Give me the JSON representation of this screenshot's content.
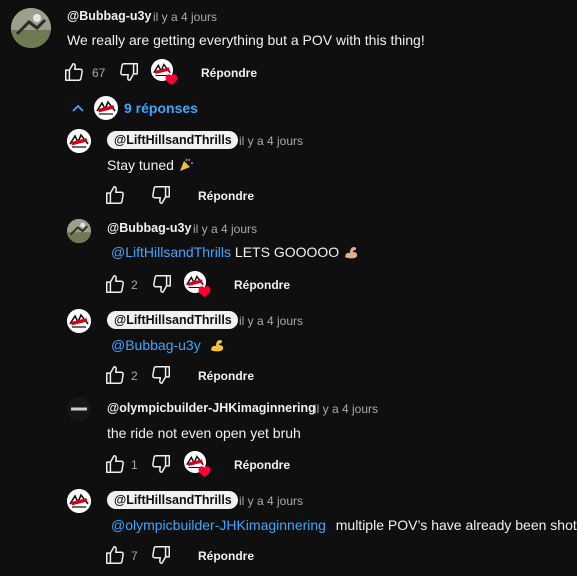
{
  "comments": {
    "c1": {
      "author": "@Bubbag-u3y",
      "time": "il y a 4 jours",
      "text": "We really are getting everything but a POV with this thing!",
      "likes": "67",
      "reply": "Répondre"
    },
    "toggle": {
      "label": "9 réponses"
    },
    "r1": {
      "author": "@LiftHillsandThrills",
      "time": "il y a 4 jours",
      "text": "Stay tuned",
      "reply": "Répondre"
    },
    "r2": {
      "author": "@Bubbag-u3y",
      "time": "il y a 4 jours",
      "mention": "@LiftHillsandThrills",
      "text": "LETS GOOOOO",
      "likes": "2",
      "reply": "Répondre"
    },
    "r3": {
      "author": "@LiftHillsandThrills",
      "time": "il y a 4 jours",
      "mention": "@Bubbag-u3y",
      "text": "",
      "likes": "2",
      "reply": "Répondre"
    },
    "r4": {
      "author": "@olympicbuilder-JHKimaginnering",
      "time": "il y a 4 jours",
      "text": "the ride not even open yet bruh",
      "likes": "1",
      "reply": "Répondre"
    },
    "r5": {
      "author": "@LiftHillsandThrills",
      "time": "il y a 4 jours",
      "mention": "@olympicbuilder-JHKimaginnering",
      "text": "multiple POV’s have already been shot",
      "likes": "7",
      "reply": "Répondre"
    }
  },
  "colors": {
    "background": "#0f0f0f",
    "text": "#f1f1f1",
    "muted": "#aaaaaa",
    "link": "#3ea6ff",
    "heart": "#ff0033"
  }
}
